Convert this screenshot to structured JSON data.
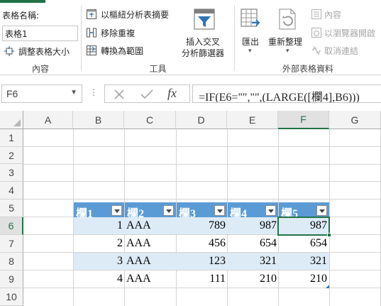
{
  "ribbon": {
    "table_name_label": "表格名稱:",
    "table_name_value": "表格1",
    "resize_table": "調整表格大小",
    "group_properties": "內容",
    "summarize_pivot": "以樞紐分析表摘要",
    "remove_duplicates": "移除重複",
    "convert_to_range": "轉換為範圍",
    "insert_slicer_line1": "插入交叉",
    "insert_slicer_line2": "分析篩選器",
    "group_tools": "工具",
    "export": "匯出",
    "refresh": "重新整理",
    "properties": "內容",
    "open_in_browser": "以瀏覽器開啟",
    "unlink": "取消連結",
    "group_external": "外部表格資料"
  },
  "formula_bar": {
    "name_box": "F6",
    "formula": "=IF(E6=\"\",\"\",(LARGE([欄4],B6)))"
  },
  "grid": {
    "columns": [
      "A",
      "B",
      "C",
      "D",
      "E",
      "F",
      "G"
    ],
    "rows": [
      "1",
      "2",
      "3",
      "4",
      "5",
      "6",
      "7",
      "8",
      "9",
      "10"
    ],
    "selected_column": "F",
    "selected_row": "6",
    "table_headers": [
      "欄1",
      "欄2",
      "欄3",
      "欄4",
      "欄5"
    ],
    "table_rows": [
      [
        "1",
        "AAA",
        "789",
        "987",
        "987"
      ],
      [
        "2",
        "AAA",
        "456",
        "654",
        "654"
      ],
      [
        "3",
        "AAA",
        "123",
        "321",
        "321"
      ],
      [
        "4",
        "AAA",
        "111",
        "210",
        "210"
      ]
    ]
  },
  "colors": {
    "accent_green": "#217346",
    "table_header_blue": "#5b9bd5",
    "table_band": "#ddebf7"
  }
}
